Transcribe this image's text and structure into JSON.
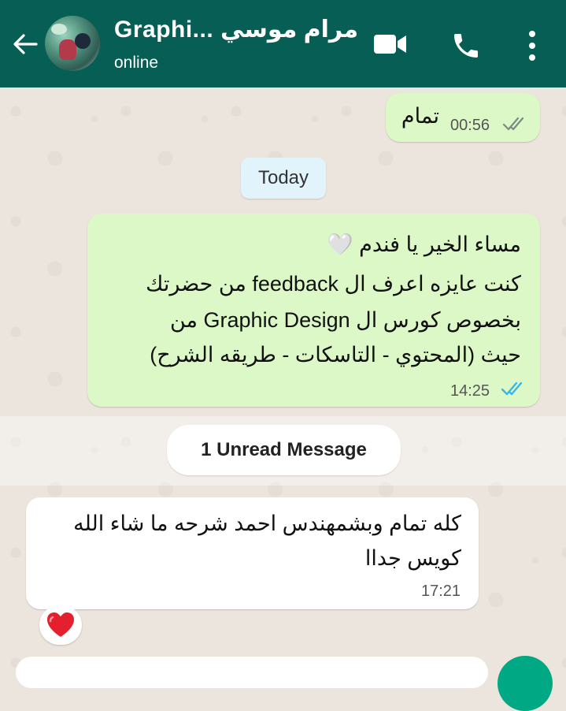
{
  "header": {
    "contact_name": "Graphi... مرام موسي",
    "status": "online",
    "colors": {
      "bar": "#075e54",
      "text": "#ffffff"
    },
    "icons": [
      "back-arrow-icon",
      "video-call-icon",
      "phone-icon",
      "more-vertical-icon"
    ]
  },
  "messages": [
    {
      "direction": "outgoing",
      "lines": [
        "تمام"
      ],
      "time": "00:56",
      "status": "read-grey"
    },
    {
      "direction": "outgoing",
      "lines": [
        "مساء الخير يا فندم 🤍",
        "كنت عايزه اعرف ال feedback  من حضرتك",
        "بخصوص كورس ال Graphic Design  من",
        "حيث (المحتوي - التاسكات - طريقه الشرح)"
      ],
      "time": "14:25",
      "status": "read-blue"
    },
    {
      "direction": "incoming",
      "lines": [
        "كله تمام وبشمهندس احمد شرحه ما شاء الله",
        "كويس جداا"
      ],
      "time": "17:21",
      "reaction": "❤️"
    }
  ],
  "date_separator": "Today",
  "unread_label": "1 Unread Message",
  "colors": {
    "outgoing_bubble": "#dcf8c6",
    "incoming_bubble": "#ffffff",
    "read_tick_blue": "#34b7f1",
    "fab": "#00a884"
  }
}
